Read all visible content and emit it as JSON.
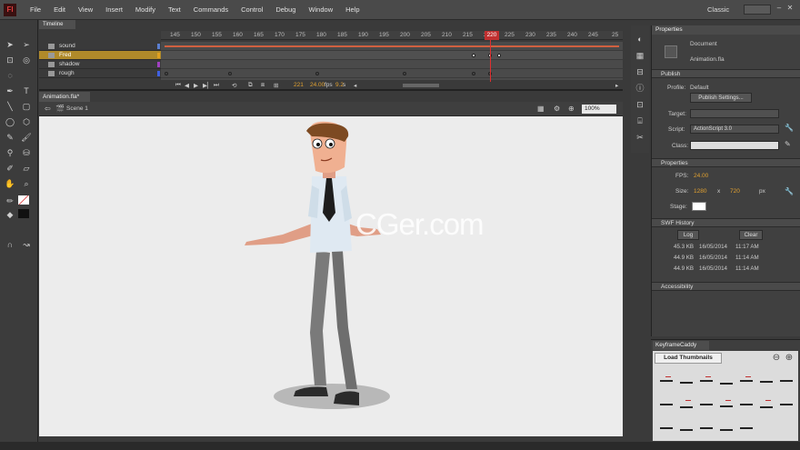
{
  "app": {
    "logo": "Fl",
    "workspace": "Classic"
  },
  "menu": [
    "File",
    "Edit",
    "View",
    "Insert",
    "Modify",
    "Text",
    "Commands",
    "Control",
    "Debug",
    "Window",
    "Help"
  ],
  "timeline": {
    "tab": "Timeline",
    "ruler": [
      "145",
      "150",
      "155",
      "160",
      "165",
      "170",
      "175",
      "180",
      "185",
      "190",
      "195",
      "200",
      "205",
      "210",
      "215",
      "220",
      "225",
      "230",
      "235",
      "240",
      "245",
      "25"
    ],
    "playhead": "220",
    "layers": [
      {
        "name": "sound",
        "color": "#5b7fd0"
      },
      {
        "name": "Fred",
        "color": "#e0a020"
      },
      {
        "name": "shadow",
        "color": "#a040c0"
      },
      {
        "name": "rough",
        "color": "#4060e0"
      }
    ],
    "current_frame": "221",
    "fps": "24.00",
    "fps_unit": "fps",
    "time": "9.2",
    "time_unit": "s"
  },
  "document": {
    "tab": "Animation.fla*",
    "scene": "Scene 1",
    "zoom": "100%"
  },
  "watermark": "CGer.com",
  "properties": {
    "tab": "Properties",
    "doc_type": "Document",
    "doc_name": "Animation.fla",
    "publish": {
      "header": "Publish",
      "profile_label": "Profile:",
      "profile_value": "Default",
      "settings_button": "Publish Settings...",
      "target_label": "Target:",
      "target_value": "",
      "script_label": "Script:",
      "script_value": "ActionScript 3.0",
      "class_label": "Class:",
      "class_value": ""
    },
    "props": {
      "header": "Properties",
      "fps_label": "FPS:",
      "fps_value": "24.00",
      "size_label": "Size:",
      "width": "1280",
      "x": "x",
      "height": "720",
      "unit": "px",
      "stage_label": "Stage:"
    },
    "swf": {
      "header": "SWF History",
      "log_button": "Log",
      "clear_button": "Clear",
      "entries": [
        {
          "size": "45.3 KB",
          "date": "16/05/2014",
          "time": "11:17 AM"
        },
        {
          "size": "44.9 KB",
          "date": "16/05/2014",
          "time": "11:14 AM"
        },
        {
          "size": "44.9 KB",
          "date": "16/05/2014",
          "time": "11:14 AM"
        }
      ]
    },
    "accessibility": "Accessibility"
  },
  "caddy": {
    "tab": "KeyframeCaddy",
    "load_button": "Load Thumbnails"
  }
}
